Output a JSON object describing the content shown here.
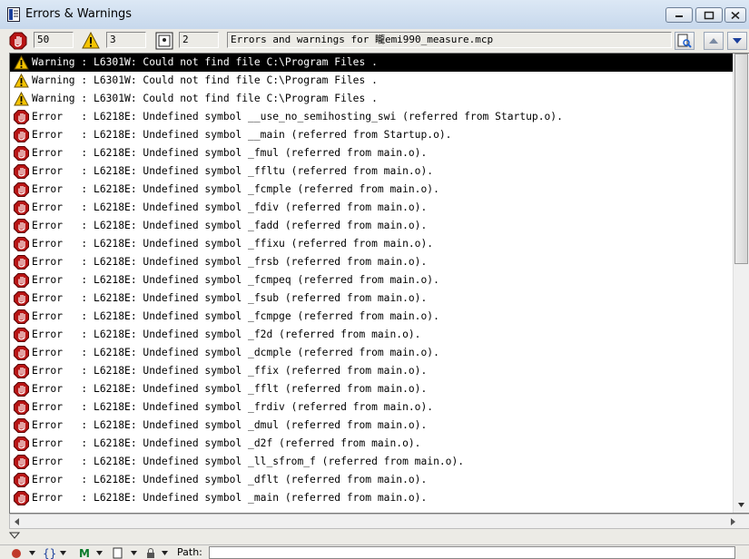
{
  "window": {
    "title": "Errors & Warnings"
  },
  "toolbar": {
    "error_count": "50",
    "warning_count": "3",
    "info_count": "2",
    "path_text": "Errors and warnings for 矓emi990_measure.mcp"
  },
  "messages": [
    {
      "type": "warning",
      "text": "Warning : L6301W: Could not find file C:\\Program Files .",
      "selected": true
    },
    {
      "type": "warning",
      "text": "Warning : L6301W: Could not find file C:\\Program Files ."
    },
    {
      "type": "warning",
      "text": "Warning : L6301W: Could not find file C:\\Program Files ."
    },
    {
      "type": "error",
      "text": "Error   : L6218E: Undefined symbol __use_no_semihosting_swi (referred from Startup.o)."
    },
    {
      "type": "error",
      "text": "Error   : L6218E: Undefined symbol __main (referred from Startup.o)."
    },
    {
      "type": "error",
      "text": "Error   : L6218E: Undefined symbol _fmul (referred from main.o)."
    },
    {
      "type": "error",
      "text": "Error   : L6218E: Undefined symbol _ffltu (referred from main.o)."
    },
    {
      "type": "error",
      "text": "Error   : L6218E: Undefined symbol _fcmple (referred from main.o)."
    },
    {
      "type": "error",
      "text": "Error   : L6218E: Undefined symbol _fdiv (referred from main.o)."
    },
    {
      "type": "error",
      "text": "Error   : L6218E: Undefined symbol _fadd (referred from main.o)."
    },
    {
      "type": "error",
      "text": "Error   : L6218E: Undefined symbol _ffixu (referred from main.o)."
    },
    {
      "type": "error",
      "text": "Error   : L6218E: Undefined symbol _frsb (referred from main.o)."
    },
    {
      "type": "error",
      "text": "Error   : L6218E: Undefined symbol _fcmpeq (referred from main.o)."
    },
    {
      "type": "error",
      "text": "Error   : L6218E: Undefined symbol _fsub (referred from main.o)."
    },
    {
      "type": "error",
      "text": "Error   : L6218E: Undefined symbol _fcmpge (referred from main.o)."
    },
    {
      "type": "error",
      "text": "Error   : L6218E: Undefined symbol _f2d (referred from main.o)."
    },
    {
      "type": "error",
      "text": "Error   : L6218E: Undefined symbol _dcmple (referred from main.o)."
    },
    {
      "type": "error",
      "text": "Error   : L6218E: Undefined symbol _ffix (referred from main.o)."
    },
    {
      "type": "error",
      "text": "Error   : L6218E: Undefined symbol _fflt (referred from main.o)."
    },
    {
      "type": "error",
      "text": "Error   : L6218E: Undefined symbol _frdiv (referred from main.o)."
    },
    {
      "type": "error",
      "text": "Error   : L6218E: Undefined symbol _dmul (referred from main.o)."
    },
    {
      "type": "error",
      "text": "Error   : L6218E: Undefined symbol _d2f (referred from main.o)."
    },
    {
      "type": "error",
      "text": "Error   : L6218E: Undefined symbol _ll_sfrom_f (referred from main.o)."
    },
    {
      "type": "error",
      "text": "Error   : L6218E: Undefined symbol _dflt (referred from main.o)."
    },
    {
      "type": "error",
      "text": "Error   : L6218E: Undefined symbol _main (referred from main.o)."
    }
  ],
  "bottom": {
    "path_label": "Path:"
  },
  "icons": {
    "error": "stop-hand-icon",
    "warning": "warning-triangle-icon",
    "info": "info-document-icon",
    "search": "search-document-icon"
  },
  "colors": {
    "error_red": "#b81414",
    "warning_yellow": "#f5c400",
    "selection": "#000000"
  }
}
